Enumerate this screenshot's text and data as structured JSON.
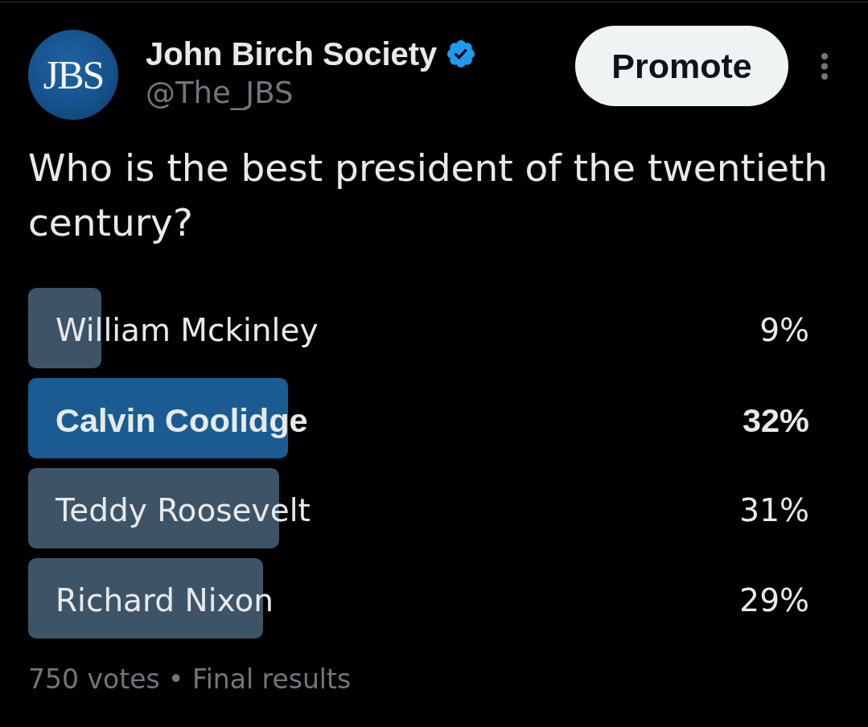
{
  "header": {
    "avatar_text": "JBS",
    "name": "John Birch Society",
    "verified": true,
    "handle": "@The_JBS",
    "action_button": "Promote"
  },
  "post": {
    "text": "Who is the best president of the twentieth century?"
  },
  "poll": {
    "options": [
      {
        "label": "William Mckinley",
        "percent": "9%",
        "level": 0.09,
        "winner": false
      },
      {
        "label": "Calvin Coolidge",
        "percent": "32%",
        "level": 0.32,
        "winner": true
      },
      {
        "label": "Teddy Roosevelt",
        "percent": "31%",
        "level": 0.31,
        "winner": false
      },
      {
        "label": "Richard Nixon",
        "percent": "29%",
        "level": 0.29,
        "winner": false
      }
    ],
    "footer": "750 votes • Final results"
  }
}
